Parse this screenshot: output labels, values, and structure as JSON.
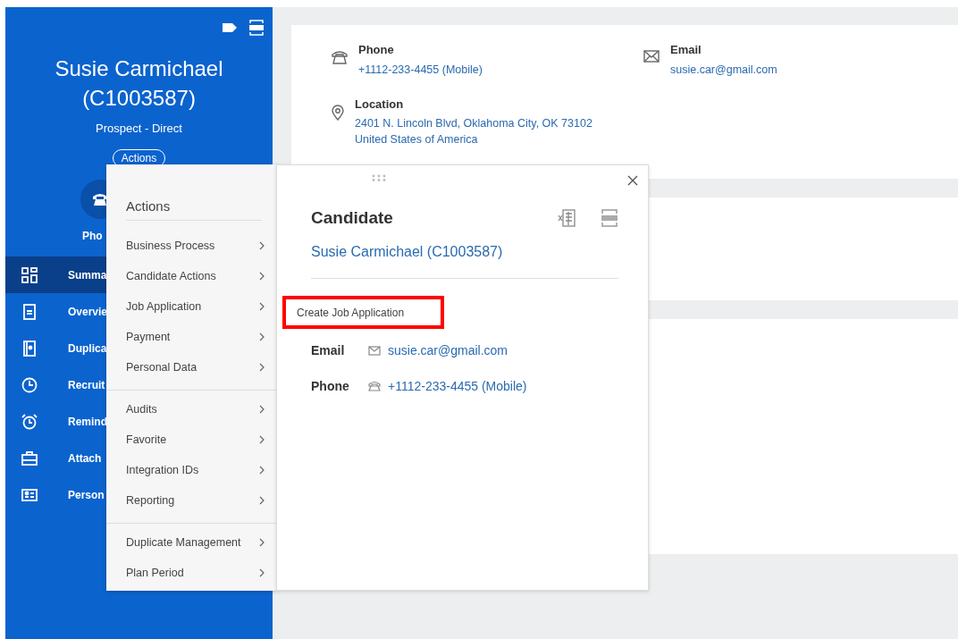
{
  "profile": {
    "name": "Susie Carmichael",
    "id": "(C1003587)",
    "status": "Prospect - Direct",
    "actions_button": "Actions",
    "quick_action_label": "Pho"
  },
  "nav": [
    {
      "label": "Summa",
      "selected": true
    },
    {
      "label": "Overvie",
      "selected": false
    },
    {
      "label": "Duplica",
      "selected": false
    },
    {
      "label": "Recruit",
      "selected": false
    },
    {
      "label": "Remind",
      "selected": false
    },
    {
      "label": "Attach",
      "selected": false
    },
    {
      "label": "Person",
      "selected": false
    }
  ],
  "contact_card": {
    "phone": {
      "label": "Phone",
      "value": "+1112-233-4455 (Mobile)"
    },
    "email": {
      "label": "Email",
      "value": "susie.car@gmail.com"
    },
    "location": {
      "label": "Location",
      "lines": [
        "2401 N. Lincoln Blvd, Oklahoma City, OK 73102",
        "United States of America"
      ]
    }
  },
  "actions_menu": {
    "title": "Actions",
    "groups": [
      [
        "Business Process",
        "Candidate Actions",
        "Job Application",
        "Payment",
        "Personal Data"
      ],
      [
        "Audits",
        "Favorite",
        "Integration IDs",
        "Reporting"
      ],
      [
        "Duplicate Management",
        "Plan Period"
      ]
    ]
  },
  "submenu": {
    "items": [
      "Create Job Application"
    ]
  },
  "candidate_popup": {
    "title": "Candidate",
    "name": "Susie Carmichael (C1003587)",
    "fields": [
      {
        "kind": "email",
        "label": "Email",
        "value": "susie.car@gmail.com"
      },
      {
        "kind": "phone",
        "label": "Phone",
        "value": "+1112-233-4455 (Mobile)"
      }
    ]
  }
}
